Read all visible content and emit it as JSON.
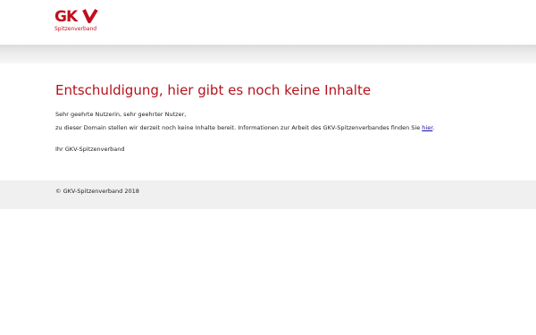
{
  "header": {
    "logo_text": "GKV",
    "logo_subtitle": "Spitzenverband",
    "brand_color": "#c10e1f"
  },
  "main": {
    "headline": "Entschuldigung, hier gibt es noch keine Inhalte",
    "salutation": "Sehr geehrte Nutzerin, sehr geehrter Nutzer,",
    "message": "zu dieser Domain stellen wir derzeit noch keine Inhalte bereit. Informationen zur Arbeit des GKV-Spitzenverbandes finden Sie ",
    "link_label": "hier",
    "message_end": ".",
    "signature": "Ihr GKV-Spitzenverband"
  },
  "footer": {
    "copyright": "© GKV-Spitzenverband 2018"
  }
}
